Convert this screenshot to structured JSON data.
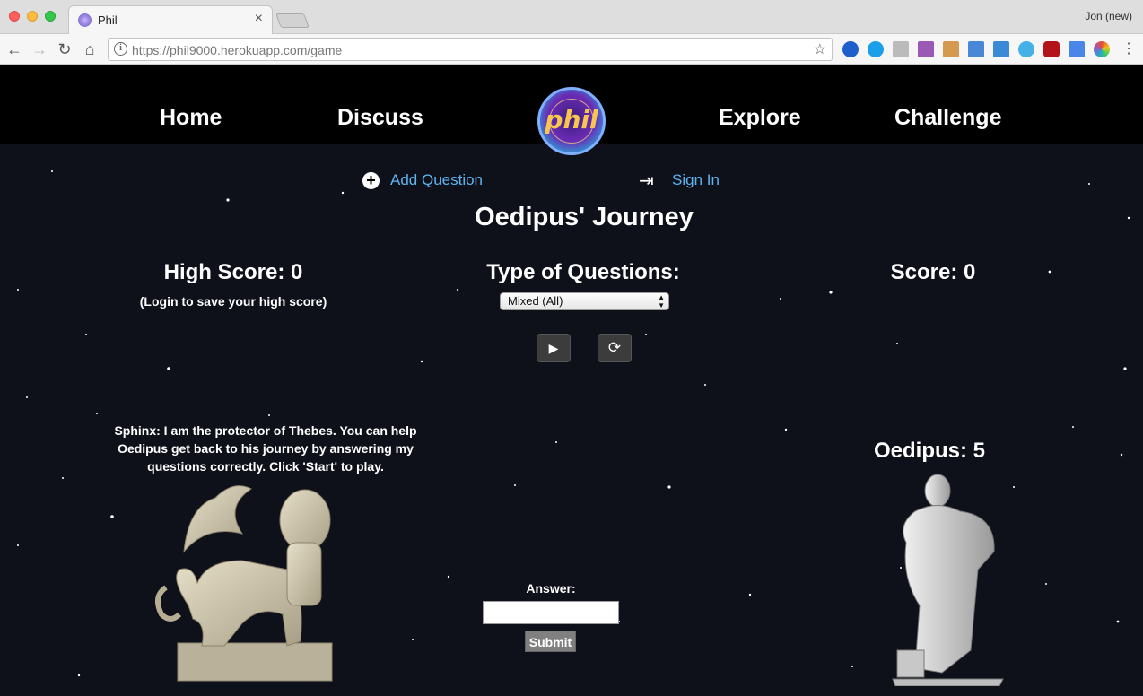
{
  "browser": {
    "tab_title": "Phil",
    "tab_close": "×",
    "profile": "Jon (new)",
    "url_host": "https://phil9000.herokuapp.com",
    "url_path": "/game",
    "info_glyph": "i",
    "star_glyph": "☆",
    "back_glyph": "←",
    "forward_glyph": "→",
    "reload_glyph": "↻",
    "home_glyph": "⌂",
    "menu_glyph": "⋮"
  },
  "nav": {
    "home": "Home",
    "discuss": "Discuss",
    "explore": "Explore",
    "challenge": "Challenge",
    "logo_text": "phil"
  },
  "subnav": {
    "add_question": "Add Question",
    "add_icon": "+",
    "sign_in": "Sign In",
    "sign_in_icon": "⇥"
  },
  "game": {
    "title": "Oedipus' Journey",
    "high_score_label": "High Score: 0",
    "login_note": "(Login to save your high score)",
    "question_type_label": "Type of Questions:",
    "question_type_selected": "Mixed (All)",
    "score_label": "Score: 0",
    "play_glyph": "▶",
    "reset_glyph": "⟳",
    "sphinx_message": "Sphinx: I am the protector of Thebes. You can help Oedipus get back to his journey by answering my questions correctly. Click 'Start' to play.",
    "oedipus_label": "Oedipus: 5",
    "answer_label": "Answer:",
    "submit_label": "Submit"
  }
}
